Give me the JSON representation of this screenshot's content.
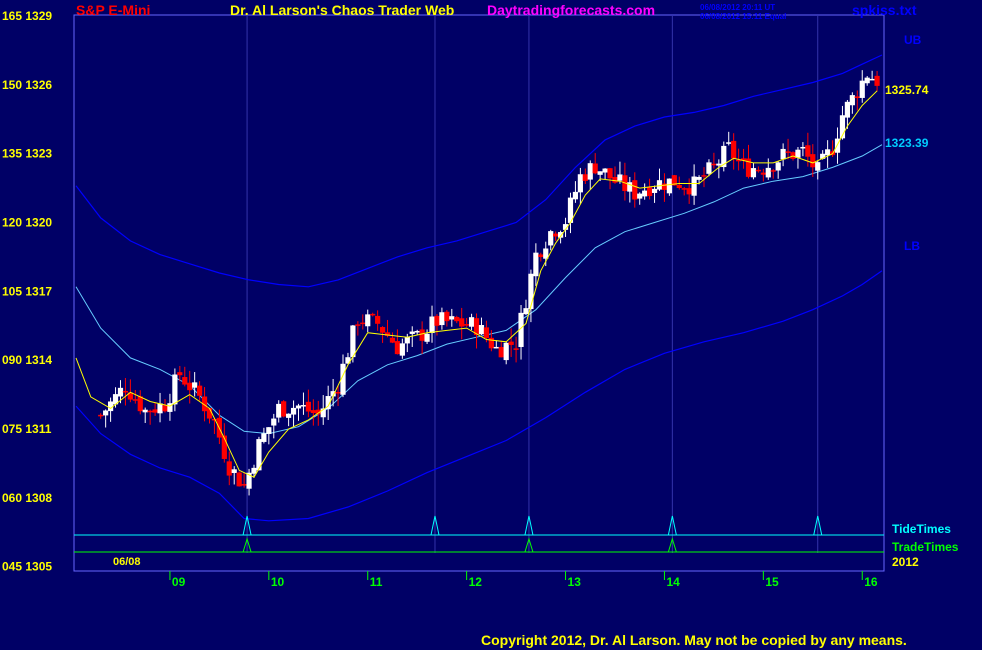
{
  "header": {
    "symbol": "S&P E-Mini",
    "title": "Dr. Al Larson's Chaos Trader Web",
    "site": "Daytradingforecasts.com",
    "stamp1": "06/08/2012 20:11 UT",
    "stamp2": "06/08/2012 15:11 Equal",
    "file": "spkiss.txt"
  },
  "footer": {
    "copyright": "Copyright 2012, Dr. Al Larson. May not be copied by any means."
  },
  "colors": {
    "background": "#000066",
    "plot_border": "#6666ff",
    "up_candle": "#ffffff",
    "down_candle": "#ff0000",
    "ma_fast": "#ffff00",
    "ma_mid": "#66ccff",
    "band": "#0000ff",
    "tide": "#00ffff",
    "trade": "#00ff00",
    "price_label": "#ffff00",
    "red_text": "#ff0000",
    "magenta_text": "#ff00ff"
  },
  "chart_data": {
    "type": "candlestick",
    "title": "S&P E-Mini",
    "ylim": [
      1304.9,
      1329.0
    ],
    "y_ticks": [
      {
        "label": "165 1329",
        "value": 1329
      },
      {
        "label": "150 1326",
        "value": 1326
      },
      {
        "label": "135 1323",
        "value": 1323
      },
      {
        "label": "120 1320",
        "value": 1320
      },
      {
        "label": "105 1317",
        "value": 1317
      },
      {
        "label": "090 1314",
        "value": 1314
      },
      {
        "label": "075 1311",
        "value": 1311
      },
      {
        "label": "060 1308",
        "value": 1308
      },
      {
        "label": "045 1305",
        "value": 1305
      }
    ],
    "x_ticks": [
      "09",
      "10",
      "11",
      "12",
      "13",
      "14",
      "15",
      "16"
    ],
    "date_label": "06/08",
    "year_label": "2012",
    "band_labels": {
      "upper": "UB",
      "lower": "LB"
    },
    "price_labels": {
      "fast": "1325.74",
      "mid": "1323.39"
    },
    "legend": [
      "TideTimes",
      "TradeTimes"
    ],
    "tide_times": [
      9.78,
      11.68,
      12.63,
      14.08,
      15.55
    ],
    "trade_times": [
      9.78,
      12.63,
      14.08
    ],
    "close_path": [
      [
        8.3,
        1311.6
      ],
      [
        8.55,
        1312.9
      ],
      [
        8.75,
        1311.8
      ],
      [
        8.95,
        1312.1
      ],
      [
        9.1,
        1313.4
      ],
      [
        9.3,
        1312.4
      ],
      [
        9.45,
        1311.3
      ],
      [
        9.6,
        1309.4
      ],
      [
        9.75,
        1308.5
      ],
      [
        9.9,
        1310.3
      ],
      [
        10.1,
        1311.9
      ],
      [
        10.3,
        1312.0
      ],
      [
        10.5,
        1311.6
      ],
      [
        10.7,
        1313.0
      ],
      [
        10.9,
        1315.8
      ],
      [
        11.1,
        1315.6
      ],
      [
        11.3,
        1314.6
      ],
      [
        11.5,
        1315.0
      ],
      [
        11.7,
        1315.7
      ],
      [
        11.9,
        1315.6
      ],
      [
        12.1,
        1315.5
      ],
      [
        12.3,
        1314.5
      ],
      [
        12.5,
        1314.8
      ],
      [
        12.7,
        1318.6
      ],
      [
        12.85,
        1319.6
      ],
      [
        13.0,
        1320.1
      ],
      [
        13.15,
        1322.0
      ],
      [
        13.3,
        1322.5
      ],
      [
        13.5,
        1321.8
      ],
      [
        13.7,
        1321.3
      ],
      [
        13.9,
        1321.7
      ],
      [
        14.1,
        1321.8
      ],
      [
        14.3,
        1321.6
      ],
      [
        14.5,
        1322.4
      ],
      [
        14.65,
        1323.2
      ],
      [
        14.8,
        1322.4
      ],
      [
        15.0,
        1322.4
      ],
      [
        15.2,
        1322.9
      ],
      [
        15.4,
        1323.1
      ],
      [
        15.55,
        1322.2
      ],
      [
        15.7,
        1323.3
      ],
      [
        15.8,
        1324.7
      ],
      [
        15.9,
        1325.4
      ],
      [
        16.05,
        1326.5
      ],
      [
        16.15,
        1326.2
      ]
    ],
    "ma_fast_pts": [
      [
        8.05,
        1314.1
      ],
      [
        8.2,
        1312.4
      ],
      [
        8.4,
        1311.9
      ],
      [
        8.6,
        1312.6
      ],
      [
        8.8,
        1312.2
      ],
      [
        9.0,
        1312.0
      ],
      [
        9.2,
        1312.5
      ],
      [
        9.4,
        1311.9
      ],
      [
        9.55,
        1310.6
      ],
      [
        9.7,
        1309.2
      ],
      [
        9.85,
        1308.9
      ],
      [
        10.0,
        1310.0
      ],
      [
        10.2,
        1311.0
      ],
      [
        10.4,
        1311.4
      ],
      [
        10.6,
        1312.0
      ],
      [
        10.8,
        1313.8
      ],
      [
        11.0,
        1315.2
      ],
      [
        11.2,
        1315.1
      ],
      [
        11.4,
        1315.0
      ],
      [
        11.6,
        1315.2
      ],
      [
        11.8,
        1315.3
      ],
      [
        12.0,
        1315.4
      ],
      [
        12.2,
        1314.9
      ],
      [
        12.4,
        1314.8
      ],
      [
        12.6,
        1315.6
      ],
      [
        12.75,
        1317.9
      ],
      [
        12.9,
        1319.1
      ],
      [
        13.05,
        1320.0
      ],
      [
        13.2,
        1321.2
      ],
      [
        13.35,
        1321.9
      ],
      [
        13.55,
        1321.8
      ],
      [
        13.75,
        1321.5
      ],
      [
        13.95,
        1321.6
      ],
      [
        14.15,
        1321.7
      ],
      [
        14.35,
        1321.7
      ],
      [
        14.55,
        1322.4
      ],
      [
        14.7,
        1322.8
      ],
      [
        14.9,
        1322.6
      ],
      [
        15.1,
        1322.6
      ],
      [
        15.3,
        1322.9
      ],
      [
        15.5,
        1322.6
      ],
      [
        15.7,
        1323.0
      ],
      [
        15.85,
        1324.2
      ],
      [
        16.0,
        1325.1
      ],
      [
        16.15,
        1325.74
      ]
    ],
    "ma_mid_pts": [
      [
        8.05,
        1317.2
      ],
      [
        8.3,
        1315.4
      ],
      [
        8.6,
        1314.1
      ],
      [
        8.9,
        1313.6
      ],
      [
        9.2,
        1312.9
      ],
      [
        9.5,
        1311.6
      ],
      [
        9.75,
        1310.9
      ],
      [
        10.0,
        1310.8
      ],
      [
        10.3,
        1311.1
      ],
      [
        10.6,
        1311.9
      ],
      [
        10.9,
        1313.1
      ],
      [
        11.2,
        1313.8
      ],
      [
        11.5,
        1314.2
      ],
      [
        11.8,
        1314.7
      ],
      [
        12.1,
        1315.0
      ],
      [
        12.4,
        1315.3
      ],
      [
        12.7,
        1316.2
      ],
      [
        13.0,
        1317.6
      ],
      [
        13.3,
        1318.9
      ],
      [
        13.6,
        1319.6
      ],
      [
        13.9,
        1320.0
      ],
      [
        14.2,
        1320.4
      ],
      [
        14.5,
        1320.9
      ],
      [
        14.8,
        1321.5
      ],
      [
        15.1,
        1321.8
      ],
      [
        15.4,
        1322.0
      ],
      [
        15.7,
        1322.4
      ],
      [
        16.0,
        1322.9
      ],
      [
        16.2,
        1323.39
      ]
    ],
    "upper_band_pts": [
      [
        8.05,
        1321.6
      ],
      [
        8.3,
        1320.2
      ],
      [
        8.6,
        1319.2
      ],
      [
        8.9,
        1318.6
      ],
      [
        9.2,
        1318.2
      ],
      [
        9.5,
        1317.8
      ],
      [
        9.8,
        1317.5
      ],
      [
        10.1,
        1317.3
      ],
      [
        10.4,
        1317.2
      ],
      [
        10.7,
        1317.5
      ],
      [
        11.0,
        1318.0
      ],
      [
        11.3,
        1318.5
      ],
      [
        11.6,
        1318.9
      ],
      [
        11.9,
        1319.2
      ],
      [
        12.2,
        1319.6
      ],
      [
        12.5,
        1320.0
      ],
      [
        12.8,
        1321.0
      ],
      [
        13.1,
        1322.4
      ],
      [
        13.4,
        1323.6
      ],
      [
        13.7,
        1324.2
      ],
      [
        14.0,
        1324.6
      ],
      [
        14.3,
        1324.8
      ],
      [
        14.6,
        1325.1
      ],
      [
        14.9,
        1325.5
      ],
      [
        15.2,
        1325.8
      ],
      [
        15.5,
        1326.1
      ],
      [
        15.8,
        1326.5
      ],
      [
        16.0,
        1326.9
      ],
      [
        16.2,
        1327.3
      ]
    ],
    "lower_band_pts": [
      [
        8.05,
        1312.0
      ],
      [
        8.3,
        1310.8
      ],
      [
        8.6,
        1309.9
      ],
      [
        8.9,
        1309.3
      ],
      [
        9.2,
        1308.9
      ],
      [
        9.5,
        1308.2
      ],
      [
        9.75,
        1307.1
      ],
      [
        10.0,
        1307.0
      ],
      [
        10.4,
        1307.1
      ],
      [
        10.8,
        1307.6
      ],
      [
        11.2,
        1308.3
      ],
      [
        11.6,
        1309.1
      ],
      [
        12.0,
        1309.8
      ],
      [
        12.4,
        1310.5
      ],
      [
        12.8,
        1311.5
      ],
      [
        13.2,
        1312.6
      ],
      [
        13.6,
        1313.6
      ],
      [
        14.0,
        1314.3
      ],
      [
        14.4,
        1314.8
      ],
      [
        14.8,
        1315.2
      ],
      [
        15.2,
        1315.7
      ],
      [
        15.5,
        1316.2
      ],
      [
        15.8,
        1316.8
      ],
      [
        16.0,
        1317.3
      ],
      [
        16.2,
        1317.9
      ]
    ]
  }
}
